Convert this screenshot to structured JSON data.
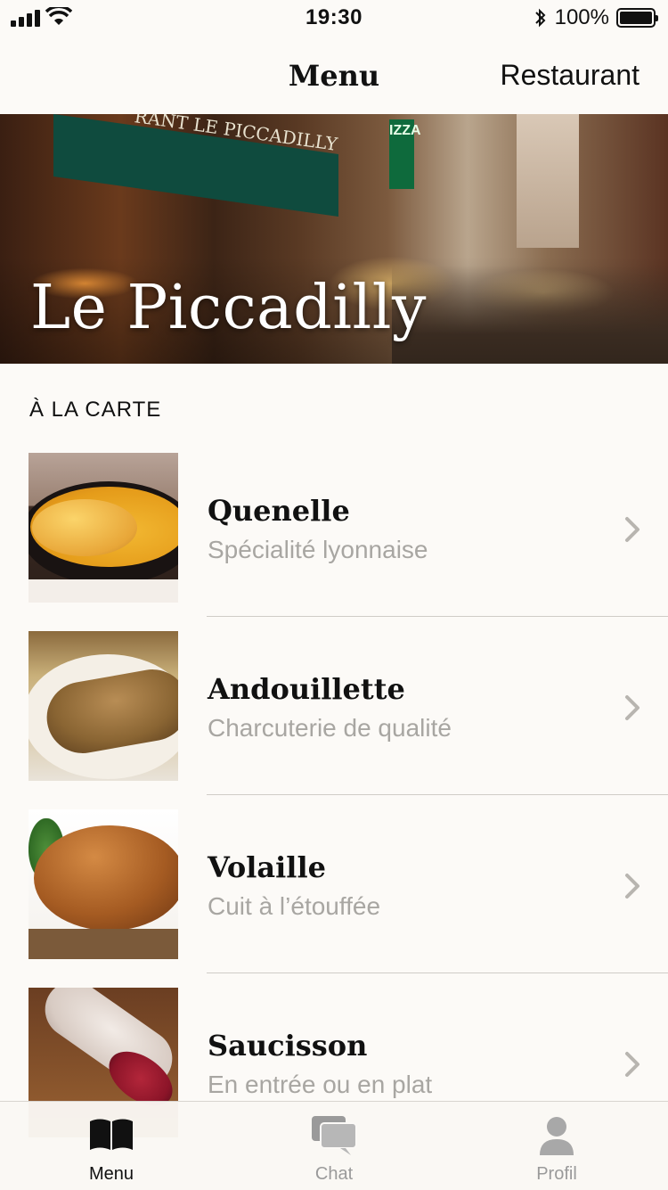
{
  "status_bar": {
    "time": "19:30",
    "battery_percent": "100%",
    "battery_level": 1.0,
    "icons": [
      "cellular-signal-icon",
      "wifi-icon",
      "bluetooth-icon",
      "battery-icon"
    ]
  },
  "nav": {
    "title": "Menu",
    "right_button": "Restaurant"
  },
  "hero": {
    "title": "Le Piccadilly",
    "awning_text": "RANT LE PICCADILLY",
    "sign_text": "IZZA"
  },
  "section": {
    "header": "À LA CARTE"
  },
  "menu_items": [
    {
      "title": "Quenelle",
      "subtitle": "Spécialité lyonnaise"
    },
    {
      "title": "Andouillette",
      "subtitle": "Charcuterie de qualité"
    },
    {
      "title": "Volaille",
      "subtitle": "Cuit à l’étouffée"
    },
    {
      "title": "Saucisson",
      "subtitle": "En entrée ou en plat"
    }
  ],
  "tab_bar": {
    "tabs": [
      {
        "label": "Menu",
        "icon": "book-icon",
        "active": true
      },
      {
        "label": "Chat",
        "icon": "chat-bubbles-icon",
        "active": false
      },
      {
        "label": "Profil",
        "icon": "person-icon",
        "active": false
      }
    ]
  },
  "colors": {
    "background": "#fcfaf7",
    "text_primary": "#111111",
    "text_secondary": "#a8a6a2",
    "tab_inactive": "#9a9a9a",
    "separator": "#cfccc7"
  }
}
